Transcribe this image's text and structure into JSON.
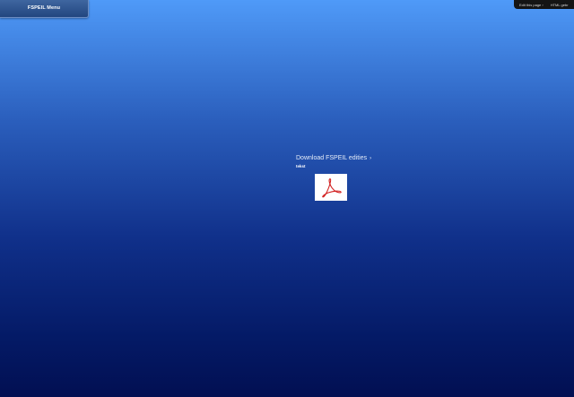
{
  "menu": {
    "label": "FSPEIL Menu"
  },
  "edit_bar": {
    "edit_label": "Edit this page ›",
    "html_label": "HTML gebr"
  },
  "main": {
    "download_label": "Download FSPEIL edities",
    "chevron": "›",
    "caption": "tekst"
  },
  "icons": {
    "pdf": "adobe-pdf-icon"
  },
  "colors": {
    "pdf_red": "#d21f1f"
  }
}
